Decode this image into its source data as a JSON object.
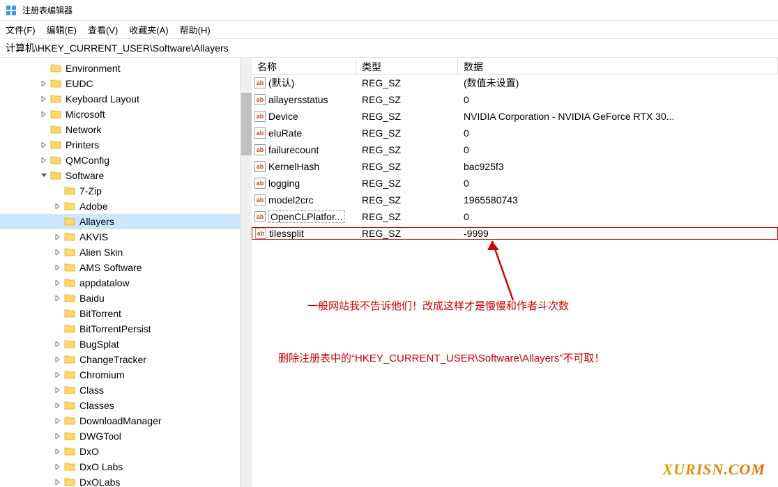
{
  "window": {
    "title": "注册表编辑器"
  },
  "menubar": {
    "file": "文件(F)",
    "edit": "编辑(E)",
    "view": "查看(V)",
    "favorites": "收藏夹(A)",
    "help": "帮助(H)"
  },
  "address": "计算机\\HKEY_CURRENT_USER\\Software\\Allayers",
  "tree": [
    {
      "label": "Environment",
      "indent": 56,
      "toggle": ""
    },
    {
      "label": "EUDC",
      "indent": 56,
      "toggle": ">"
    },
    {
      "label": "Keyboard Layout",
      "indent": 56,
      "toggle": ">"
    },
    {
      "label": "Microsoft",
      "indent": 56,
      "toggle": ">"
    },
    {
      "label": "Network",
      "indent": 56,
      "toggle": ""
    },
    {
      "label": "Printers",
      "indent": 56,
      "toggle": ">"
    },
    {
      "label": "QMConfig",
      "indent": 56,
      "toggle": ">"
    },
    {
      "label": "Software",
      "indent": 56,
      "toggle": "v"
    },
    {
      "label": "7-Zip",
      "indent": 76,
      "toggle": ""
    },
    {
      "label": "Adobe",
      "indent": 76,
      "toggle": ">"
    },
    {
      "label": "Allayers",
      "indent": 76,
      "toggle": "",
      "selected": true
    },
    {
      "label": "AKVIS",
      "indent": 76,
      "toggle": ">"
    },
    {
      "label": "Alien Skin",
      "indent": 76,
      "toggle": ">"
    },
    {
      "label": "AMS Software",
      "indent": 76,
      "toggle": ">"
    },
    {
      "label": "appdatalow",
      "indent": 76,
      "toggle": ">"
    },
    {
      "label": "Baidu",
      "indent": 76,
      "toggle": ">"
    },
    {
      "label": "BitTorrent",
      "indent": 76,
      "toggle": ""
    },
    {
      "label": "BitTorrentPersist",
      "indent": 76,
      "toggle": ""
    },
    {
      "label": "BugSplat",
      "indent": 76,
      "toggle": ">"
    },
    {
      "label": "ChangeTracker",
      "indent": 76,
      "toggle": ">"
    },
    {
      "label": "Chromium",
      "indent": 76,
      "toggle": ">"
    },
    {
      "label": "Class",
      "indent": 76,
      "toggle": ">"
    },
    {
      "label": "Classes",
      "indent": 76,
      "toggle": ">"
    },
    {
      "label": "DownloadManager",
      "indent": 76,
      "toggle": ">"
    },
    {
      "label": "DWGTool",
      "indent": 76,
      "toggle": ">"
    },
    {
      "label": "DxO",
      "indent": 76,
      "toggle": ">"
    },
    {
      "label": "DxO Labs",
      "indent": 76,
      "toggle": ">"
    },
    {
      "label": "DxOLabs",
      "indent": 76,
      "toggle": ">"
    }
  ],
  "list": {
    "headers": {
      "name": "名称",
      "type": "类型",
      "data": "数据"
    },
    "rows": [
      {
        "name": "(默认)",
        "type": "REG_SZ",
        "data": "(数值未设置)"
      },
      {
        "name": "ailayersstatus",
        "type": "REG_SZ",
        "data": "0"
      },
      {
        "name": "Device",
        "type": "REG_SZ",
        "data": "NVIDIA Corporation - NVIDIA GeForce RTX 30..."
      },
      {
        "name": "eluRate",
        "type": "REG_SZ",
        "data": "0"
      },
      {
        "name": "failurecount",
        "type": "REG_SZ",
        "data": "0"
      },
      {
        "name": "KernelHash",
        "type": "REG_SZ",
        "data": "bac925f3"
      },
      {
        "name": "logging",
        "type": "REG_SZ",
        "data": "0"
      },
      {
        "name": "model2crc",
        "type": "REG_SZ",
        "data": "1965580743"
      },
      {
        "name": "OpenCLPlatfor...",
        "type": "REG_SZ",
        "data": "0",
        "boxed": true
      },
      {
        "name": "tilessplit",
        "type": "REG_SZ",
        "data": "-9999",
        "highlighted": true
      }
    ]
  },
  "annotations": {
    "line1": "一般网站我不告诉他们！改成这样才是慢慢和作者斗次数",
    "line2": "删除注册表中的“HKEY_CURRENT_USER\\Software\\Allayers”不可取！"
  },
  "watermark": "XURISN.COM"
}
